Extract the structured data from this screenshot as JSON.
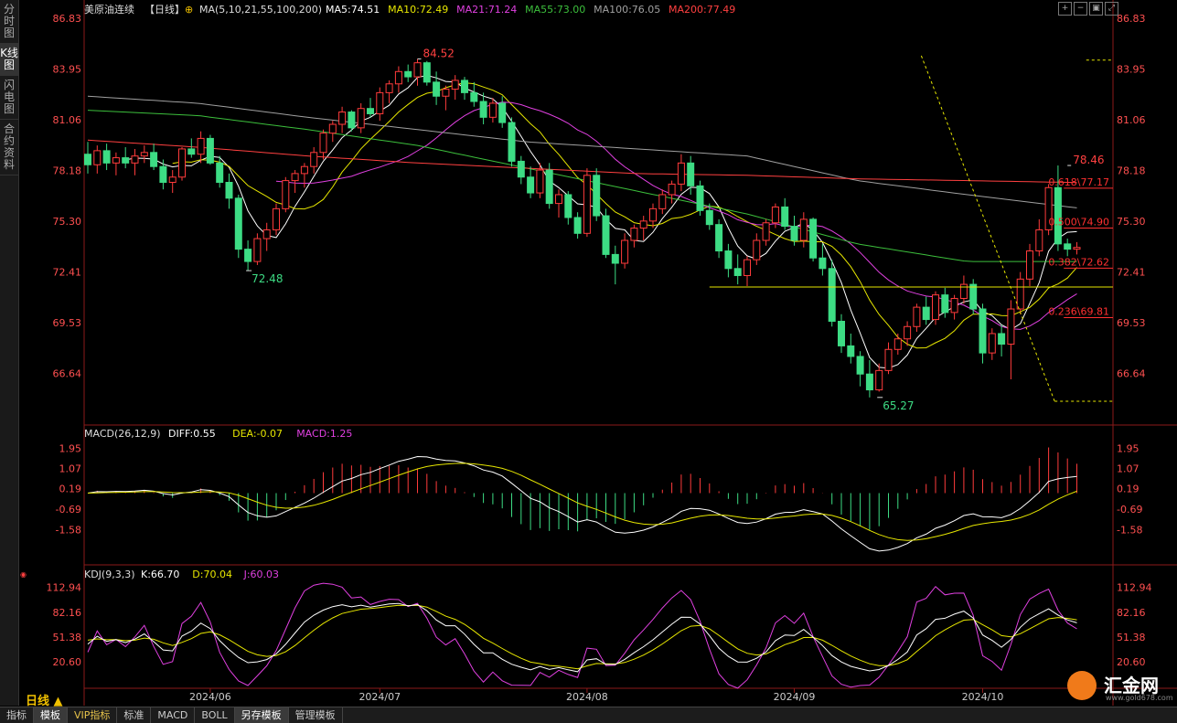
{
  "left_tabs": [
    "分时图",
    "K线图",
    "闪电图",
    "合约资料"
  ],
  "active_left_tab": 1,
  "header": {
    "title": "美原油连续",
    "period_tag": "【日线】",
    "ma_params": "MA(5,10,21,55,100,200)",
    "ma_values": [
      {
        "label": "MA5:74.51",
        "color": "#ffffff"
      },
      {
        "label": "MA10:72.49",
        "color": "#e6e600"
      },
      {
        "label": "MA21:71.24",
        "color": "#e040e0"
      },
      {
        "label": "MA55:73.00",
        "color": "#3cbf3c"
      },
      {
        "label": "MA100:76.05",
        "color": "#a0a0a0"
      },
      {
        "label": "MA200:77.49",
        "color": "#ff4040"
      }
    ]
  },
  "toolbar_icons": [
    "zoom-in-icon",
    "zoom-out-icon",
    "fit-icon",
    "fullscreen-icon"
  ],
  "chart_data": [
    {
      "type": "candlestick",
      "instrument": "美原油连续",
      "period": "日线",
      "y_ticks": [
        "86.83",
        "83.95",
        "81.06",
        "78.18",
        "75.30",
        "72.41",
        "69.53",
        "66.64"
      ],
      "ylim": [
        65.0,
        86.83
      ],
      "x_labels": [
        "2024/06",
        "2024/07",
        "2024/08",
        "2024/09",
        "2024/10"
      ],
      "x_label_idx": [
        13,
        31,
        53,
        75,
        95
      ],
      "colors": {
        "up": "#ff3b3b",
        "down": "#3ddc84"
      },
      "ohlc": [
        [
          79.1,
          79.8,
          78.0,
          78.5
        ],
        [
          78.5,
          79.6,
          78.0,
          79.3
        ],
        [
          79.3,
          79.7,
          78.2,
          78.6
        ],
        [
          78.6,
          79.2,
          77.9,
          78.9
        ],
        [
          78.9,
          79.5,
          78.3,
          78.6
        ],
        [
          78.6,
          79.4,
          77.9,
          79.0
        ],
        [
          79.0,
          79.6,
          78.6,
          79.2
        ],
        [
          79.2,
          79.7,
          78.2,
          78.4
        ],
        [
          78.4,
          78.8,
          77.1,
          77.5
        ],
        [
          77.5,
          78.2,
          76.9,
          77.8
        ],
        [
          77.8,
          79.5,
          77.6,
          79.4
        ],
        [
          79.4,
          80.0,
          78.9,
          79.1
        ],
        [
          79.1,
          80.4,
          78.6,
          80.0
        ],
        [
          80.0,
          80.2,
          78.5,
          78.6
        ],
        [
          78.6,
          79.0,
          77.2,
          77.5
        ],
        [
          77.5,
          78.0,
          76.0,
          76.6
        ],
        [
          76.6,
          76.8,
          73.2,
          73.7
        ],
        [
          73.7,
          74.2,
          72.48,
          73.0
        ],
        [
          73.0,
          74.6,
          72.8,
          74.3
        ],
        [
          74.3,
          75.2,
          73.6,
          74.8
        ],
        [
          74.8,
          76.3,
          74.5,
          76.0
        ],
        [
          76.0,
          77.8,
          75.8,
          77.6
        ],
        [
          77.6,
          78.2,
          76.9,
          78.0
        ],
        [
          78.0,
          78.6,
          77.2,
          78.4
        ],
        [
          78.4,
          79.5,
          78.0,
          79.2
        ],
        [
          79.2,
          80.5,
          78.8,
          80.3
        ],
        [
          80.3,
          81.0,
          79.8,
          80.8
        ],
        [
          80.8,
          81.8,
          80.3,
          81.5
        ],
        [
          81.5,
          81.6,
          80.4,
          80.6
        ],
        [
          80.6,
          82.0,
          80.3,
          81.7
        ],
        [
          81.7,
          82.3,
          81.2,
          81.4
        ],
        [
          81.4,
          82.9,
          81.0,
          82.6
        ],
        [
          82.6,
          83.3,
          82.0,
          83.1
        ],
        [
          83.1,
          84.1,
          82.6,
          83.8
        ],
        [
          83.8,
          84.2,
          83.2,
          83.5
        ],
        [
          83.5,
          84.52,
          83.0,
          84.3
        ],
        [
          84.3,
          84.4,
          83.0,
          83.2
        ],
        [
          83.2,
          83.8,
          81.9,
          82.4
        ],
        [
          82.4,
          83.0,
          81.6,
          82.8
        ],
        [
          82.8,
          83.6,
          82.2,
          83.3
        ],
        [
          83.3,
          83.5,
          82.2,
          82.6
        ],
        [
          82.6,
          83.2,
          81.8,
          82.1
        ],
        [
          82.1,
          82.6,
          80.8,
          81.2
        ],
        [
          81.2,
          82.3,
          80.9,
          82.0
        ],
        [
          82.0,
          82.4,
          80.6,
          80.9
        ],
        [
          80.9,
          81.2,
          78.4,
          78.7
        ],
        [
          78.7,
          79.0,
          77.4,
          77.8
        ],
        [
          77.8,
          78.4,
          76.6,
          76.9
        ],
        [
          76.9,
          78.6,
          76.6,
          78.2
        ],
        [
          78.2,
          78.6,
          76.0,
          76.3
        ],
        [
          76.3,
          77.1,
          75.5,
          76.8
        ],
        [
          76.8,
          77.0,
          75.1,
          75.5
        ],
        [
          75.5,
          75.8,
          74.3,
          74.6
        ],
        [
          74.6,
          78.3,
          74.4,
          77.9
        ],
        [
          77.9,
          78.3,
          75.3,
          75.6
        ],
        [
          75.6,
          76.0,
          73.2,
          73.4
        ],
        [
          73.4,
          73.9,
          71.7,
          72.9
        ],
        [
          72.9,
          74.6,
          72.6,
          74.2
        ],
        [
          74.2,
          75.1,
          73.8,
          74.9
        ],
        [
          74.9,
          75.6,
          74.2,
          75.3
        ],
        [
          75.3,
          76.3,
          74.9,
          76.0
        ],
        [
          76.0,
          77.1,
          75.7,
          76.8
        ],
        [
          76.8,
          77.6,
          76.3,
          77.4
        ],
        [
          77.4,
          79.1,
          77.0,
          78.6
        ],
        [
          78.6,
          79.0,
          76.8,
          77.3
        ],
        [
          77.3,
          77.6,
          75.6,
          75.9
        ],
        [
          75.9,
          76.3,
          74.8,
          75.1
        ],
        [
          75.1,
          75.4,
          73.2,
          73.6
        ],
        [
          73.6,
          74.0,
          72.1,
          72.6
        ],
        [
          72.6,
          73.4,
          71.7,
          72.2
        ],
        [
          72.2,
          73.3,
          71.6,
          73.1
        ],
        [
          73.1,
          74.6,
          72.8,
          74.2
        ],
        [
          74.2,
          75.4,
          73.9,
          75.2
        ],
        [
          75.2,
          76.3,
          74.9,
          76.1
        ],
        [
          76.1,
          76.6,
          74.8,
          75.0
        ],
        [
          75.0,
          75.6,
          73.9,
          74.2
        ],
        [
          74.2,
          75.8,
          73.8,
          75.4
        ],
        [
          75.4,
          75.5,
          73.0,
          73.2
        ],
        [
          73.2,
          74.0,
          72.2,
          72.6
        ],
        [
          72.6,
          73.1,
          69.3,
          69.6
        ],
        [
          69.6,
          70.0,
          67.8,
          68.2
        ],
        [
          68.2,
          68.9,
          67.2,
          67.6
        ],
        [
          67.6,
          67.9,
          65.9,
          66.6
        ],
        [
          66.6,
          67.4,
          65.27,
          65.7
        ],
        [
          65.7,
          67.2,
          65.6,
          66.8
        ],
        [
          66.8,
          68.4,
          66.6,
          68.0
        ],
        [
          68.0,
          68.9,
          67.7,
          68.6
        ],
        [
          68.6,
          69.6,
          68.2,
          69.3
        ],
        [
          69.3,
          70.6,
          69.0,
          70.4
        ],
        [
          70.4,
          71.0,
          69.4,
          69.7
        ],
        [
          69.7,
          71.3,
          69.4,
          71.1
        ],
        [
          71.1,
          71.5,
          69.8,
          70.1
        ],
        [
          70.1,
          71.1,
          69.7,
          70.9
        ],
        [
          70.9,
          72.2,
          70.6,
          71.7
        ],
        [
          71.7,
          72.0,
          70.0,
          70.3
        ],
        [
          70.3,
          70.6,
          67.2,
          67.8
        ],
        [
          67.8,
          69.2,
          67.4,
          68.9
        ],
        [
          68.9,
          69.4,
          67.6,
          68.3
        ],
        [
          68.3,
          70.8,
          66.3,
          70.3
        ],
        [
          70.3,
          72.4,
          70.0,
          72.0
        ],
        [
          72.0,
          74.0,
          71.6,
          73.6
        ],
        [
          73.6,
          75.4,
          73.3,
          74.8
        ],
        [
          74.8,
          77.4,
          74.5,
          77.2
        ],
        [
          77.2,
          78.46,
          73.6,
          74.0
        ],
        [
          74.0,
          74.3,
          73.3,
          73.7
        ],
        [
          73.7,
          74.1,
          73.4,
          73.8
        ]
      ],
      "moving_averages": [
        {
          "name": "MA5",
          "value": 74.51,
          "color": "#ffffff",
          "period": 5
        },
        {
          "name": "MA10",
          "value": 72.49,
          "color": "#e6e600",
          "period": 10
        },
        {
          "name": "MA21",
          "value": 71.24,
          "color": "#e040e0",
          "period": 21
        },
        {
          "name": "MA55",
          "value": 73.0,
          "color": "#3cbf3c",
          "series": [
            81.6,
            81.3,
            80.5,
            79.6,
            78.3,
            77.0,
            75.7,
            74.0,
            73.0,
            73.0
          ]
        },
        {
          "name": "MA100",
          "value": 76.05,
          "color": "#a0a0a0",
          "series": [
            82.4,
            82.0,
            81.2,
            80.5,
            79.8,
            79.4,
            79.0,
            77.6,
            76.8,
            76.05
          ]
        },
        {
          "name": "MA200",
          "value": 77.49,
          "color": "#ff4040",
          "series": [
            79.9,
            79.5,
            79.0,
            78.6,
            78.3,
            78.0,
            77.9,
            77.7,
            77.6,
            77.49
          ]
        }
      ],
      "annotations": [
        {
          "text": "84.52",
          "kind": "high",
          "index": 35,
          "price": 84.52,
          "color": "#ff4040"
        },
        {
          "text": "72.48",
          "kind": "low",
          "index": 17,
          "price": 72.48,
          "color": "#3ddc84"
        },
        {
          "text": "65.27",
          "kind": "low",
          "index": 84,
          "price": 65.27,
          "color": "#3ddc84"
        },
        {
          "text": "78.46",
          "kind": "high",
          "index": 104,
          "price": 78.46,
          "color": "#ff4040"
        }
      ],
      "fibonacci": [
        {
          "label": "0.618\\77.17",
          "price": 77.17
        },
        {
          "label": "0.500\\74.90",
          "price": 74.9
        },
        {
          "label": "0.382\\72.62",
          "price": 72.62
        },
        {
          "label": "0.236\\69.81",
          "price": 69.81
        }
      ],
      "support_line": 71.55
    },
    {
      "type": "macd",
      "title": "MACD(26,12,9)",
      "legend": [
        {
          "label": "DIFF:0.55",
          "color": "#ffffff"
        },
        {
          "label": "DEA:-0.07",
          "color": "#e6e600"
        },
        {
          "label": "MACD:1.25",
          "color": "#e040e0"
        }
      ],
      "y_ticks": [
        "1.95",
        "1.07",
        "0.19",
        "-0.69",
        "-1.58"
      ],
      "ylim": [
        -2.4,
        2.2
      ]
    },
    {
      "type": "kdj",
      "title": "KDJ(9,3,3)",
      "legend": [
        {
          "label": "K:66.70",
          "color": "#ffffff"
        },
        {
          "label": "D:70.04",
          "color": "#e6e600"
        },
        {
          "label": "J:60.03",
          "color": "#e040e0"
        }
      ],
      "y_ticks": [
        "112.94",
        "82.16",
        "51.38",
        "20.60"
      ],
      "ylim": [
        5,
        125
      ]
    }
  ],
  "period_label": "日线 ▲",
  "bottom_tabs": [
    "指标",
    "模板",
    "VIP指标",
    "标准",
    "MACD",
    "BOLL",
    "另存模板",
    "管理模板"
  ],
  "active_bottom_tabs": [
    1,
    6
  ],
  "logo": {
    "text": "汇金网",
    "url": "www.gold678.com"
  }
}
